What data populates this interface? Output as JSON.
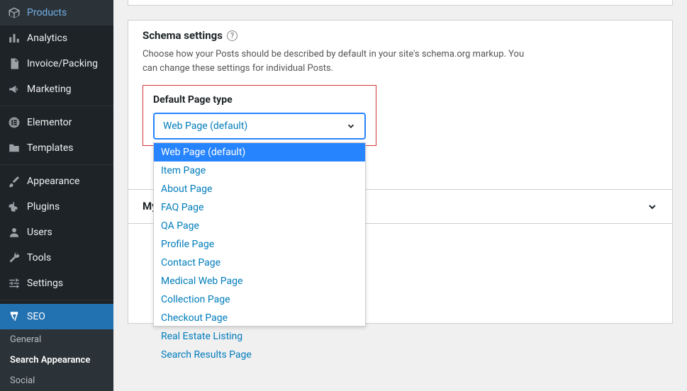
{
  "sidebar": {
    "items": [
      {
        "label": "Products"
      },
      {
        "label": "Analytics"
      },
      {
        "label": "Invoice/Packing"
      },
      {
        "label": "Marketing"
      },
      {
        "label": "Elementor"
      },
      {
        "label": "Templates"
      },
      {
        "label": "Appearance"
      },
      {
        "label": "Plugins"
      },
      {
        "label": "Users"
      },
      {
        "label": "Tools"
      },
      {
        "label": "Settings"
      },
      {
        "label": "SEO"
      }
    ],
    "sub": [
      {
        "label": "General"
      },
      {
        "label": "Search Appearance"
      },
      {
        "label": "Social"
      }
    ]
  },
  "schema": {
    "title": "Schema settings",
    "desc": "Choose how your Posts should be described by default in your site's schema.org markup. You can change these settings for individual Posts.",
    "label": "Default Page type",
    "selected": "Web Page (default)",
    "options": [
      "Web Page (default)",
      "Item Page",
      "About Page",
      "FAQ Page",
      "QA Page",
      "Profile Page",
      "Contact Page",
      "Medical Web Page",
      "Collection Page",
      "Checkout Page",
      "Real Estate Listing",
      "Search Results Page"
    ]
  },
  "templates_accordion": {
    "label": "My Templates",
    "slug": "elementor_library"
  }
}
